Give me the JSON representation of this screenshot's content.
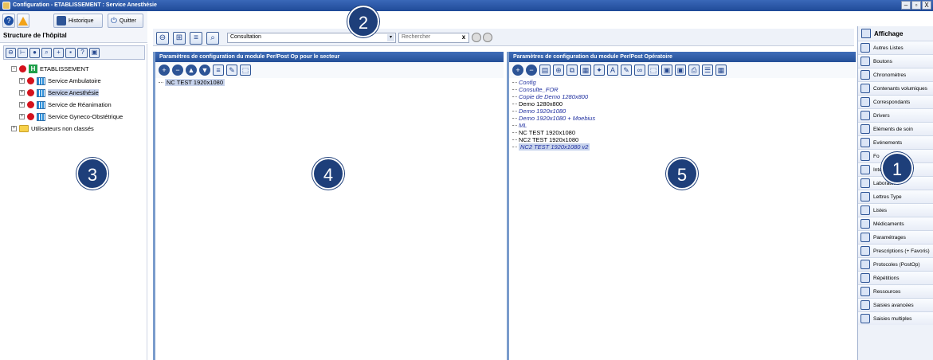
{
  "window": {
    "title": "Configuration - ETABLISSEMENT : Service Anesthésie",
    "minimize": "–",
    "restore": "▫",
    "close": "X"
  },
  "left_toolbar": {
    "historique_label": "Historique",
    "quitter_label": "Quitter"
  },
  "structure": {
    "title": "Structure de l'hôpital",
    "tree": [
      {
        "label": "ETABLISSEMENT",
        "level": 0,
        "icon": "hospital-icon"
      },
      {
        "label": "Service Ambulatoire",
        "level": 1,
        "icon": "grid-icon"
      },
      {
        "label": "Service Anesthésie",
        "level": 1,
        "icon": "grid-icon",
        "selected": true
      },
      {
        "label": "Service de Réanimation",
        "level": 1,
        "icon": "grid-icon"
      },
      {
        "label": "Service Gyneco-Obstétrique",
        "level": 1,
        "icon": "grid-icon"
      },
      {
        "label": "Utilisateurs non classés",
        "level": 0,
        "icon": "folder-icon"
      }
    ]
  },
  "main_toolbar": {
    "combo_value": "Consultation",
    "search_placeholder": "Rechercher",
    "search_clear": "x"
  },
  "sector_panel": {
    "header": "Paramètres de configuration du module Per/Post Op pour le secteur",
    "items": [
      {
        "label": "NC TEST 1920x1080",
        "selected": true,
        "italic": false
      }
    ]
  },
  "operatoire_panel": {
    "header": "Paramètres de configuration du module Per/Post Opératoire",
    "items": [
      {
        "label": "Config",
        "italic": true,
        "selected": false
      },
      {
        "label": "Consulte_FOR",
        "italic": true,
        "selected": false
      },
      {
        "label": "Copie de Demo 1280x800",
        "italic": true,
        "selected": false
      },
      {
        "label": "Demo 1280x800",
        "italic": false,
        "selected": false
      },
      {
        "label": "Demo 1920x1080",
        "italic": true,
        "selected": false
      },
      {
        "label": "Demo 1920x1080 + Moebius",
        "italic": true,
        "selected": false
      },
      {
        "label": "ML",
        "italic": true,
        "selected": false
      },
      {
        "label": "NC TEST 1920x1080",
        "italic": false,
        "selected": false
      },
      {
        "label": "NC2 TEST 1920x1080",
        "italic": false,
        "selected": false
      },
      {
        "label": "NC2 TEST 1920x1080 v2",
        "italic": true,
        "selected": true
      }
    ]
  },
  "sidebar": {
    "header": "Affichage",
    "items": [
      "Autres Listes",
      "Boutons",
      "Chronomètres",
      "Contenants volumiques",
      "Correspondants",
      "Drivers",
      "Eléments de soin",
      "Evénements",
      "Fo",
      "Inte",
      "Laboratoire",
      "Lettres Type",
      "Listes",
      "Médicaments",
      "Paramétrages",
      "Prescriptions (+ Favoris)",
      "Protocoles (PostOp)",
      "Répétitions",
      "Ressources",
      "Saisies avancées",
      "Saisies multiples"
    ]
  },
  "badges": [
    "1",
    "2",
    "3",
    "4",
    "5"
  ],
  "colors": {
    "titlebar": "#2a56a6",
    "panel_header": "#2f5ea8",
    "badge": "#1e3f7a",
    "selection": "#c7d3ec"
  }
}
